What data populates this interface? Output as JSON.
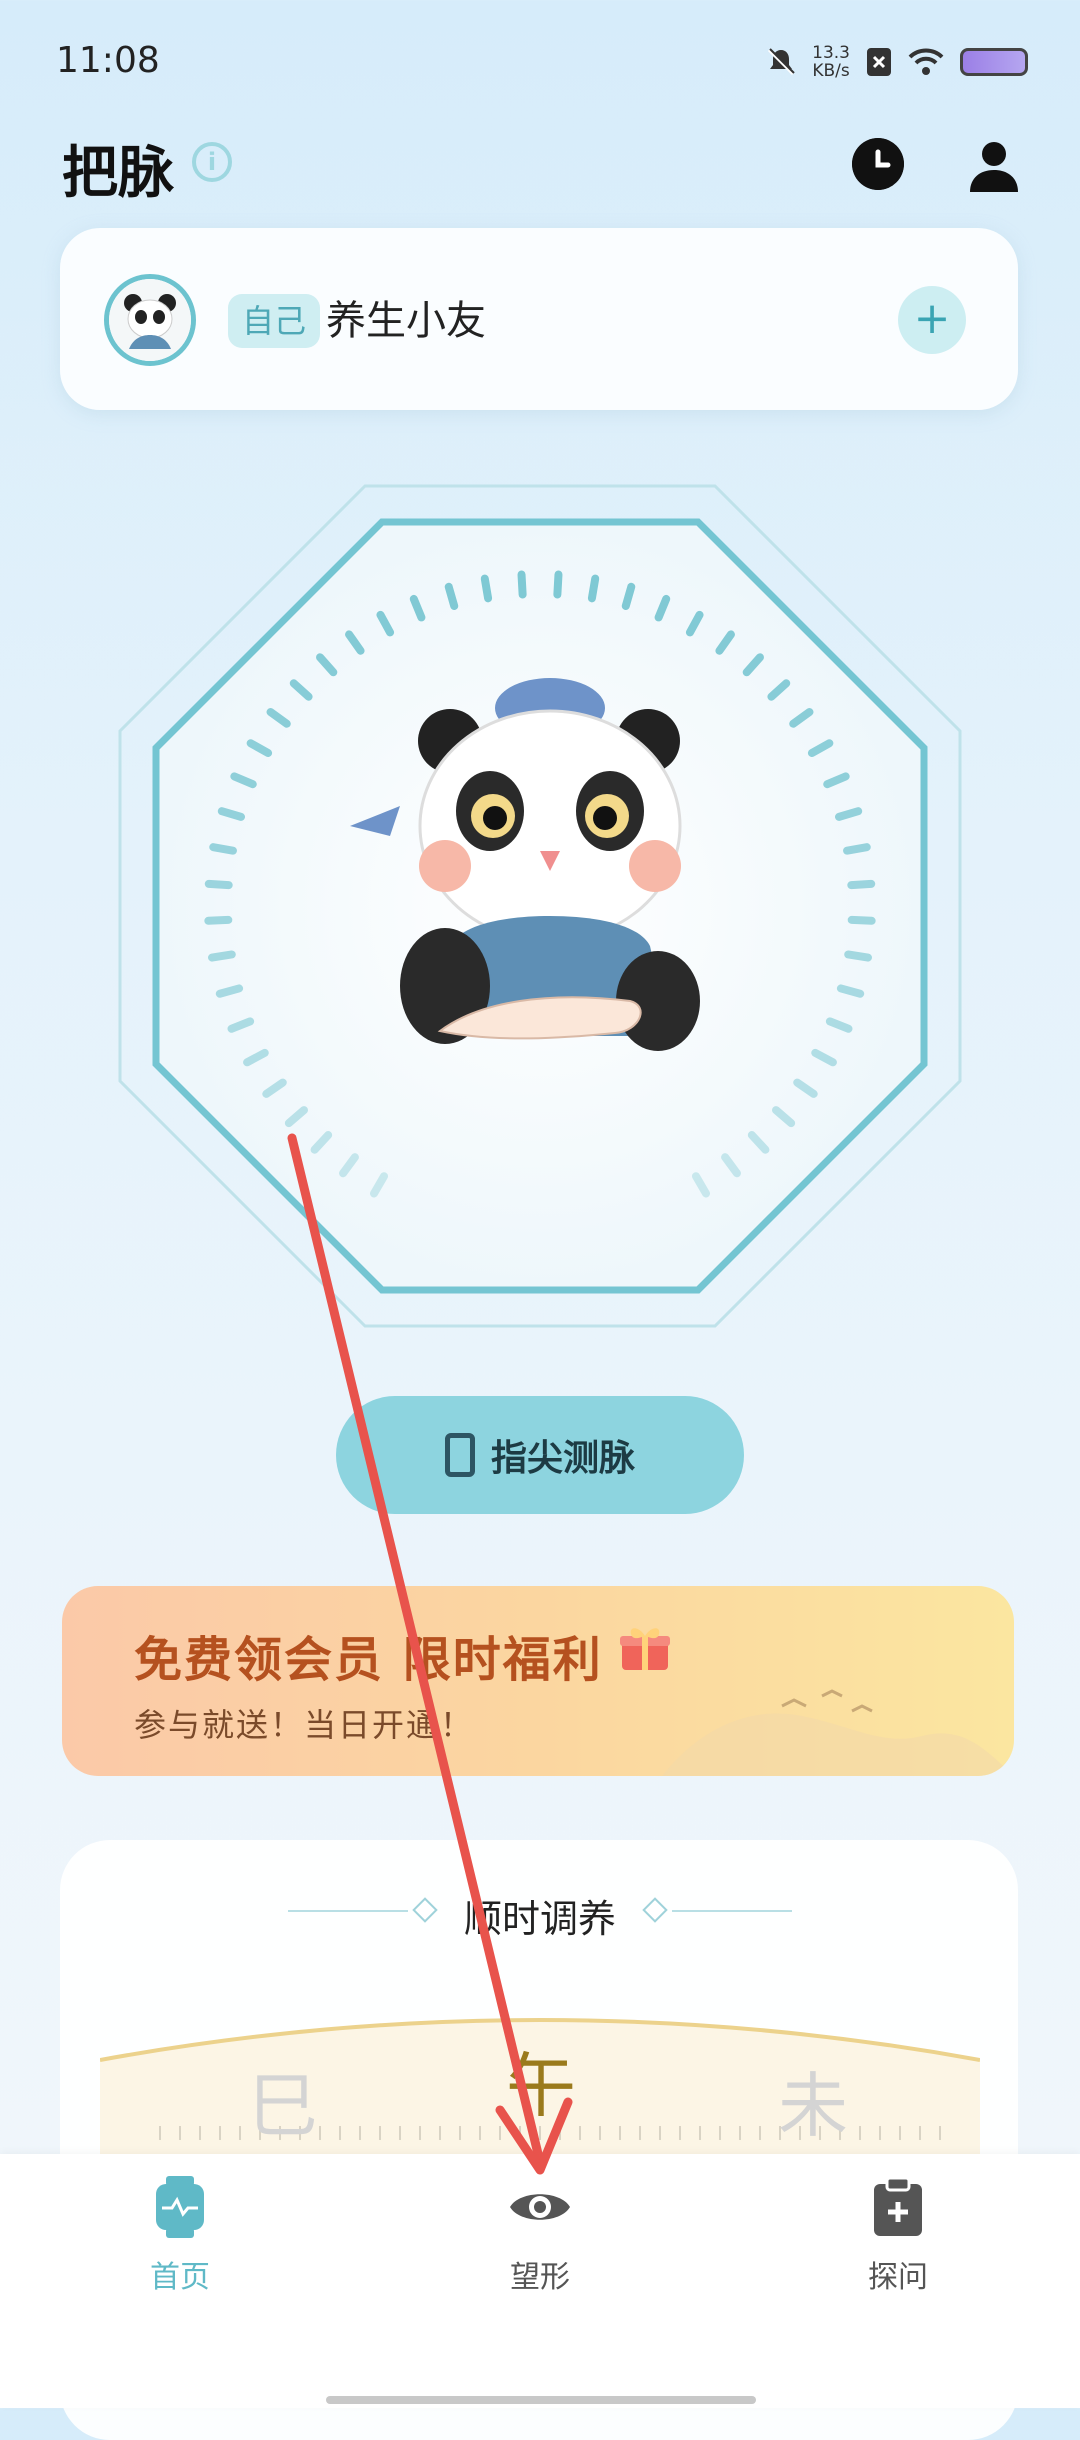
{
  "status_bar": {
    "time": "11:08",
    "speed_value": "13.3",
    "speed_unit": "KB/s"
  },
  "header": {
    "title": "把脉"
  },
  "profile": {
    "tag": "自己",
    "name": "养生小友"
  },
  "measure_button": {
    "label": "指尖测脉"
  },
  "promo": {
    "title": "免费领会员 限时福利",
    "subtitle": "参与就送！当日开通！"
  },
  "section": {
    "title": "顺时调养",
    "hours": [
      "巳",
      "午",
      "未"
    ]
  },
  "tabs": [
    {
      "label": "首页",
      "active": true
    },
    {
      "label": "望形",
      "active": false
    },
    {
      "label": "探问",
      "active": false
    }
  ],
  "colors": {
    "accent": "#5fb9c7",
    "promo_title": "#b5511f",
    "annotation_arrow": "#e8534c"
  }
}
